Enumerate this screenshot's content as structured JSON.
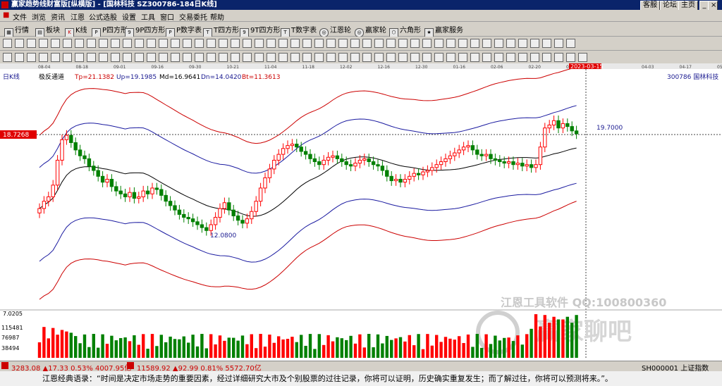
{
  "window": {
    "title": "赢家趋势线财富版[纵横版] - [国林科技   SZ300786-184日K线]",
    "buttons": [
      "客服",
      "论坛",
      "主页"
    ]
  },
  "menu": [
    "文件",
    "浏览",
    "资讯",
    "江恩",
    "公式选股",
    "设置",
    "工具",
    "窗口",
    "交易委托",
    "帮助"
  ],
  "toolbar1": [
    "行情",
    "板块",
    "K线",
    "P四方形",
    "9P四方形",
    "P数字表",
    "T四方形",
    "9T四方形",
    "T数字表",
    "江恩轮",
    "赢家轮",
    "六角形",
    "赢家服务"
  ],
  "chart_header": {
    "period": "日K线",
    "indicator": "极反通道",
    "tp": "Tp=21.1382",
    "up": "Up=19.1985",
    "md": "Md=16.9641",
    "dn": "Dn=14.0420",
    "bt": "Bt=11.3613",
    "stock": "300786 国林科技",
    "cursor_date": "2023-03-15",
    "price_tag": "18.7268",
    "high_label": "19.7000",
    "low_label": "12.0800"
  },
  "date_ticks": [
    "08-04",
    "08-18",
    "09-01",
    "09-16",
    "09-30",
    "10-21",
    "11-04",
    "11-18",
    "12-02",
    "12-16",
    "12-30",
    "01-16",
    "02-06",
    "02-20",
    "03-06",
    "2023-03-15",
    "04-03",
    "04-17",
    "05-01"
  ],
  "volume_axis": [
    "7.0205",
    "115481",
    "76987",
    "38494"
  ],
  "watermark": {
    "line1": "江恩工具软件  QQ:100800360",
    "line2": "赢家聊吧"
  },
  "colors": {
    "up": "#ff0000",
    "down": "#008000",
    "upper_band": "#cc0000",
    "mid_band": "#1a1aa0",
    "lower_band": "#1a1aa0",
    "ma": "#000000"
  },
  "ticker": {
    "sh": "3283.08",
    "sh_chg": "▲17.33",
    "sh_pct": "0.53%",
    "sh_amt": "4007.95亿",
    "sz": "11589.92",
    "sz_chg": "▲92.99",
    "sz_pct": "0.81%",
    "sz_amt": "5572.70亿",
    "right": "SH000001 上证指数"
  },
  "quote": "江恩经典语录：“时间是决定市场走势的重要因素，经过详细研究大市及个别股票的过往记录，你将可以证明，历史确实重复发生；而了解过往，你将可以预测将来。”。",
  "chart_data": {
    "type": "candlestick",
    "price_range": [
      11.0,
      24.0
    ],
    "closes": [
      13.6,
      14.1,
      14.4,
      15.2,
      16.9,
      18.3,
      18.6,
      18.1,
      17.6,
      17.2,
      17.0,
      16.5,
      16.2,
      15.8,
      15.4,
      15.6,
      15.1,
      14.8,
      14.6,
      14.4,
      14.7,
      14.3,
      14.4,
      14.8,
      14.6,
      15.0,
      14.9,
      14.5,
      14.1,
      13.8,
      13.5,
      13.2,
      13.0,
      12.9,
      12.7,
      12.5,
      12.3,
      12.1,
      12.5,
      13.0,
      13.6,
      14.0,
      13.5,
      13.1,
      12.8,
      12.6,
      12.9,
      13.4,
      14.1,
      15.0,
      15.7,
      16.3,
      16.9,
      17.3,
      17.7,
      17.9,
      18.0,
      17.8,
      17.5,
      17.3,
      17.0,
      16.8,
      16.6,
      16.9,
      17.1,
      17.2,
      17.0,
      16.8,
      16.6,
      16.5,
      16.7,
      16.9,
      17.0,
      16.8,
      16.6,
      16.5,
      16.2,
      15.8,
      15.5,
      15.6,
      15.4,
      15.6,
      15.8,
      16.0,
      15.9,
      16.1,
      16.2,
      16.4,
      16.6,
      16.8,
      17.0,
      17.2,
      17.4,
      17.6,
      17.8,
      17.9,
      17.6,
      17.3,
      17.2,
      17.3,
      17.0,
      16.9,
      16.8,
      16.7,
      16.8,
      16.6,
      16.7,
      16.5,
      16.6,
      16.4,
      16.6,
      17.8,
      19.1,
      19.3,
      19.6,
      19.1,
      19.4,
      19.2,
      18.9,
      18.7
    ]
  }
}
